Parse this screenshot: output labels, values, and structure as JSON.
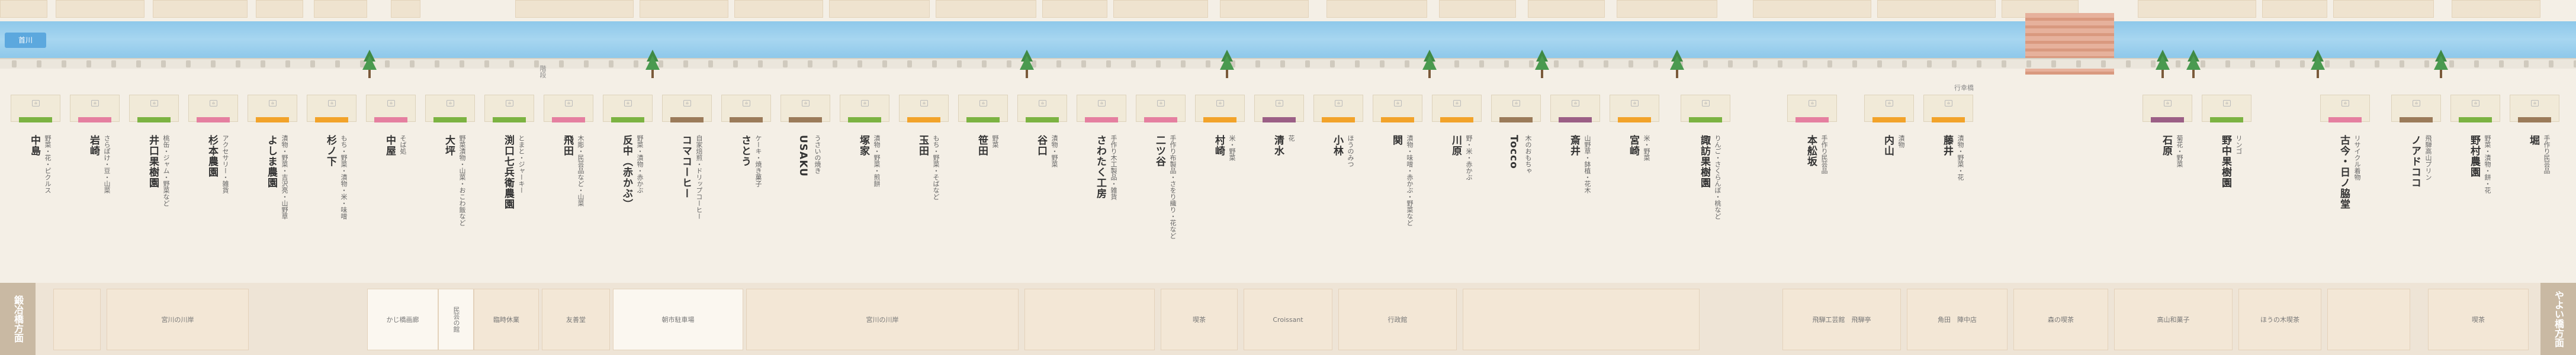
{
  "river": {
    "badge": "首川"
  },
  "path_labels": {
    "left": "階段",
    "right": "行幸橋"
  },
  "colors": {
    "green": "#7cb342",
    "pink": "#e57fa0",
    "orange": "#f2a32a",
    "brown": "#9b7b5a",
    "purple": "#9b5f86"
  },
  "stalls": [
    {
      "name": "中島",
      "desc": "野菜・花・ピクルス",
      "color": "green"
    },
    {
      "name": "岩崎",
      "desc": "さらぽけ・豆・山菜",
      "color": "pink"
    },
    {
      "name": "井口果樹園",
      "desc": "桃缶・ジャム・野菜など",
      "color": "green"
    },
    {
      "name": "杉本農園",
      "desc": "アクセサリー・雑貨",
      "color": "pink"
    },
    {
      "name": "よしま農園",
      "desc": "漬物・野菜・吉沢亮・山野草",
      "color": "orange"
    },
    {
      "name": "杉ノ下",
      "desc": "もち・野菜・漬物・米・味噌",
      "color": "orange"
    },
    {
      "name": "中屋",
      "desc": "そば処",
      "color": "pink"
    },
    {
      "name": "大坪",
      "desc": "野菜漬物・山菜・おこわ飯など",
      "color": "green"
    },
    {
      "name": "渕口七兵衛農園",
      "desc": "とまと・ジャーキー",
      "color": "green"
    },
    {
      "name": "飛田",
      "desc": "木彫・民芸品など・山菜",
      "color": "pink"
    },
    {
      "name": "反中（赤かぶ）",
      "desc": "野菜・漬物・赤かぶ",
      "color": "green"
    },
    {
      "name": "コマコーヒー",
      "desc": "自家焙煎・ドリップコーヒー",
      "color": "brown"
    },
    {
      "name": "さとう",
      "desc": "ケーキ・焼き菓子",
      "color": "brown"
    },
    {
      "name": "USAKU",
      "desc": "うさいの焼き",
      "color": "brown"
    },
    {
      "name": "塚家",
      "desc": "漬物・野菜・煎餅",
      "color": "green"
    },
    {
      "name": "玉田",
      "desc": "もち・野菜・そばなど",
      "color": "orange"
    },
    {
      "name": "笹田",
      "desc": "野菜",
      "color": "green"
    },
    {
      "name": "谷口",
      "desc": "漬物・野菜",
      "color": "green"
    },
    {
      "name": "さわたく工房",
      "desc": "手作り木工製品・雑貨",
      "color": "pink"
    },
    {
      "name": "二ツ谷",
      "desc": "手作り布製品・さをり織り・花など",
      "color": "pink"
    },
    {
      "name": "村崎",
      "desc": "米・野菜",
      "color": "orange"
    },
    {
      "name": "清水",
      "desc": "花",
      "color": "purple"
    },
    {
      "name": "小林",
      "desc": "ほうのみつ",
      "color": "orange"
    },
    {
      "name": "関",
      "desc": "漬物・味噌・赤かぶ・野菜など",
      "color": "orange"
    },
    {
      "name": "川原",
      "desc": "野・米・赤かぶ",
      "color": "orange"
    },
    {
      "name": "Tocco",
      "desc": "木のおもちゃ",
      "color": "brown"
    },
    {
      "name": "斎井",
      "desc": "山野草・鉢植・花木",
      "color": "purple"
    },
    {
      "name": "宮崎",
      "desc": "米・野菜",
      "color": "orange"
    },
    {
      "name": "諏訪果樹園",
      "desc": "りんご・さくらんぼ・桃など",
      "color": "green"
    },
    {
      "name": "本舩坂",
      "desc": "手作り民芸品",
      "color": "pink"
    },
    {
      "name": "内山",
      "desc": "漬物",
      "color": "orange"
    },
    {
      "name": "藤井",
      "desc": "漬物・野菜・花",
      "color": "orange"
    },
    {
      "name": "石原",
      "desc": "菊花・野菜",
      "color": "purple"
    },
    {
      "name": "野中果樹園",
      "desc": "リンゴ",
      "color": "green"
    },
    {
      "name": "古今・日ノ脇堂",
      "desc": "リサイクル着物",
      "color": "pink"
    },
    {
      "name": "ノアドココ",
      "desc": "飛騨高山プリン",
      "color": "brown"
    },
    {
      "name": "野村農園",
      "desc": "野菜・漬物・餅・花",
      "color": "green"
    },
    {
      "name": "堀",
      "desc": "手作り民芸品",
      "color": "brown"
    }
  ],
  "bottom": {
    "left_side": "鍛冶橋方面",
    "right_side": "やよい橋方面",
    "boxes": [
      {
        "label": ""
      },
      {
        "label": "宮川の川岸"
      },
      {
        "label": "かじ橋画廊"
      },
      {
        "label": "民芸の館"
      },
      {
        "label": "臨時休業"
      },
      {
        "label": "友善堂"
      },
      {
        "label": "朝市駐車場"
      },
      {
        "label": "宮川の川岸"
      },
      {
        "label": ""
      },
      {
        "label": "喫茶"
      },
      {
        "label": "Croissant"
      },
      {
        "label": "行政館"
      },
      {
        "label": ""
      },
      {
        "label": "飛騨工芸館　飛騨亭"
      },
      {
        "label": "角田　陣中店"
      },
      {
        "label": "森の喫茶"
      },
      {
        "label": "高山和菓子"
      },
      {
        "label": "ほうの木喫茶"
      },
      {
        "label": ""
      },
      {
        "label": "喫茶"
      }
    ]
  }
}
